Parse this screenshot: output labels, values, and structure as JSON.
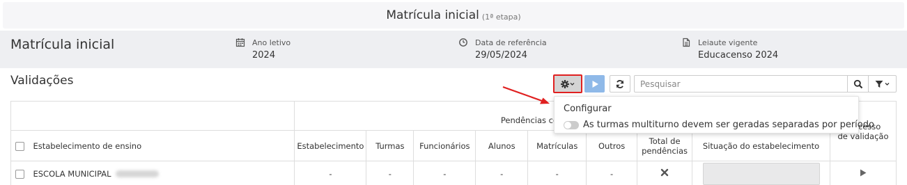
{
  "header": {
    "title": "Matrícula inicial",
    "subtitle": "(1ª etapa)"
  },
  "info": {
    "page_title": "Matrícula inicial",
    "items": [
      {
        "icon": "calendar-icon",
        "label": "Ano letivo",
        "value": "2024"
      },
      {
        "icon": "clock-icon",
        "label": "Data de referência",
        "value": "29/05/2024"
      },
      {
        "icon": "document-icon",
        "label": "Leiaute vigente",
        "value": "Educacenso 2024"
      }
    ]
  },
  "validations": {
    "title": "Validações",
    "search_placeholder": "Pesquisar"
  },
  "toolbar": {
    "config_icon": "gear-icon",
    "run_icon": "play-icon",
    "refresh_icon": "refresh-icon",
    "search_icon": "search-icon",
    "filter_icon": "filter-icon",
    "highlight_color": "#e02020",
    "run_color": "#8fb9e8"
  },
  "dropdown": {
    "title": "Configurar",
    "option_label": "As turmas multiturno devem ser geradas separadas por período",
    "option_checked": false
  },
  "table": {
    "group_header": "Pendências com o Educacenso",
    "process_header_line1": "Processo",
    "process_header_line2": "de validação",
    "columns": [
      "Estabelecimento de ensino",
      "Estabelecimento",
      "Turmas",
      "Funcionários",
      "Alunos",
      "Matrículas",
      "Outros",
      "Total de pendências",
      "Situação do estabelecimento"
    ],
    "rows": [
      {
        "school": "ESCOLA MUNICIPAL",
        "estabelecimento": "-",
        "turmas": "-",
        "funcionarios": "-",
        "alunos": "-",
        "matriculas": "-",
        "outros": "-",
        "total_icon": "x-icon",
        "action_icon": "play-icon"
      }
    ]
  }
}
